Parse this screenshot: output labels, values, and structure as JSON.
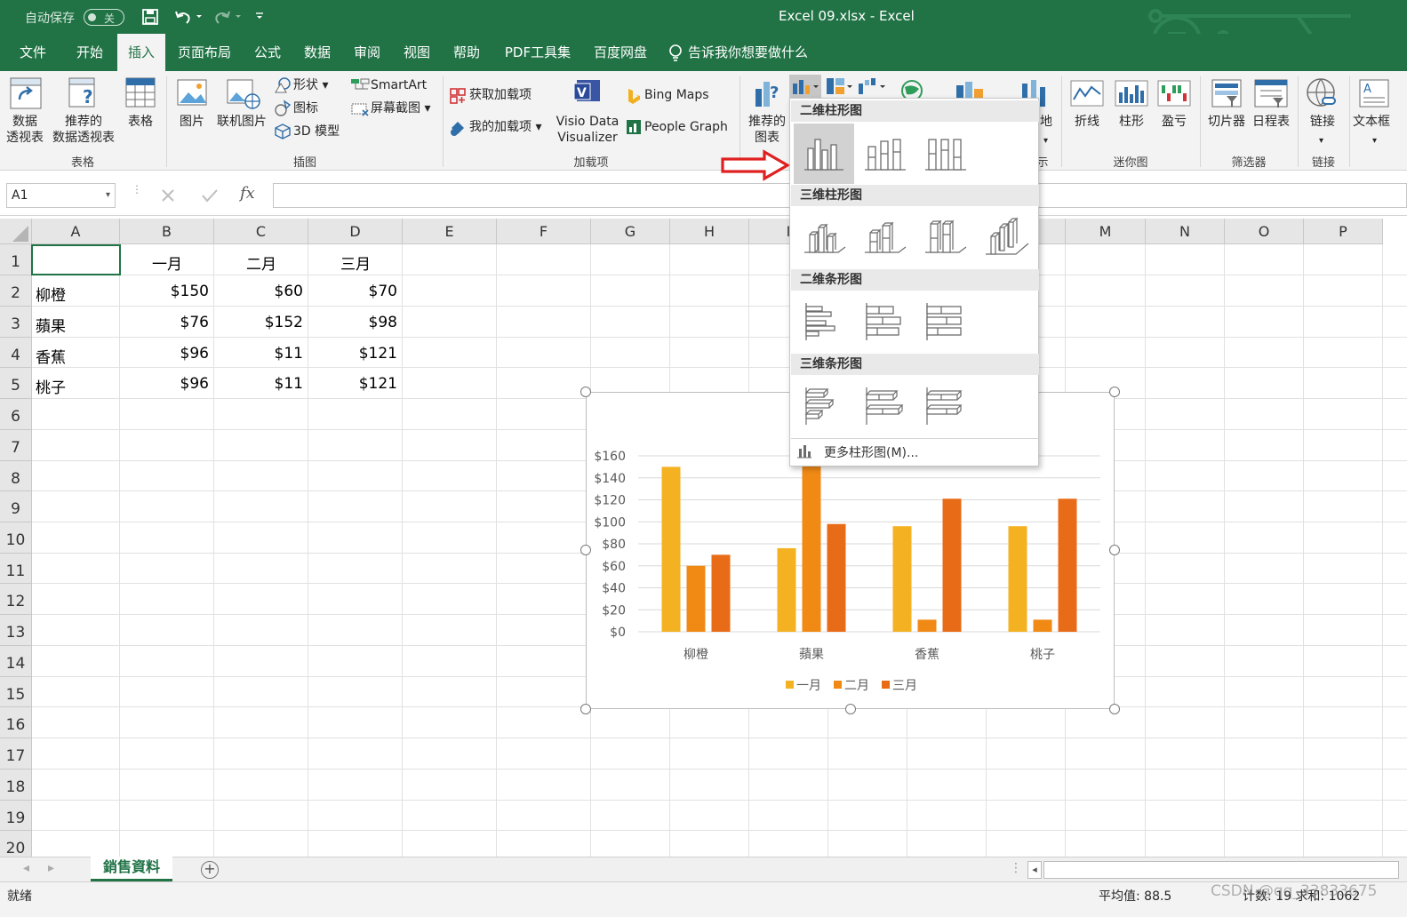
{
  "titlebar": {
    "autosave_label": "自动保存",
    "autosave_state": "关",
    "title": "Excel 09.xlsx  -  Excel"
  },
  "tabs": [
    {
      "label": "文件",
      "active": false
    },
    {
      "label": "开始",
      "active": false
    },
    {
      "label": "插入",
      "active": true
    },
    {
      "label": "页面布局",
      "active": false
    },
    {
      "label": "公式",
      "active": false
    },
    {
      "label": "数据",
      "active": false
    },
    {
      "label": "审阅",
      "active": false
    },
    {
      "label": "视图",
      "active": false
    },
    {
      "label": "帮助",
      "active": false
    },
    {
      "label": "PDF工具集",
      "active": false
    },
    {
      "label": "百度网盘",
      "active": false
    }
  ],
  "tellme": "告诉我你想要做什么",
  "ribbon": {
    "pivot": [
      "数据",
      "透视表"
    ],
    "recommended_pivot": [
      "推荐的",
      "数据透视表"
    ],
    "table": "表格",
    "group_tables": "表格",
    "picture": "图片",
    "online_picture": "联机图片",
    "shapes": "形状",
    "icons": "图标",
    "model3d": "3D 模型",
    "smartart": "SmartArt",
    "screenshot": "屏幕截图",
    "group_illustrations": "插图",
    "get_addins": "获取加载项",
    "my_addins": "我的加载项",
    "visio": [
      "Visio Data",
      "Visualizer"
    ],
    "bing_maps": "Bing Maps",
    "people_graph": "People Graph",
    "group_addins": "加载项",
    "recommended_charts": [
      "推荐的",
      "图表"
    ],
    "map_partial": "地",
    "show_partial": "示",
    "spark_line": "折线",
    "spark_column": "柱形",
    "spark_winloss": "盈亏",
    "group_sparklines": "迷你图",
    "slicer": "切片器",
    "timeline": "日程表",
    "group_filters": "筛选器",
    "link": "链接",
    "group_links": "链接",
    "textbox": "文本框"
  },
  "formula_bar": {
    "name_box": "A1",
    "fx": "fx"
  },
  "grid": {
    "columns": [
      "A",
      "B",
      "C",
      "D",
      "E",
      "F",
      "G",
      "H",
      "I",
      "",
      "",
      "L",
      "M",
      "N",
      "O",
      "P"
    ],
    "rows": [
      "1",
      "2",
      "3",
      "4",
      "5",
      "6",
      "7",
      "8",
      "9",
      "10",
      "11",
      "12",
      "13",
      "14",
      "15",
      "16",
      "17",
      "18",
      "19",
      "20"
    ],
    "cells": [
      {
        "row": 0,
        "col": 1,
        "text": "一月",
        "align": "center"
      },
      {
        "row": 0,
        "col": 2,
        "text": "二月",
        "align": "center"
      },
      {
        "row": 0,
        "col": 3,
        "text": "三月",
        "align": "center"
      },
      {
        "row": 1,
        "col": 0,
        "text": "柳橙",
        "align": "left"
      },
      {
        "row": 1,
        "col": 1,
        "text": "$150",
        "align": "right"
      },
      {
        "row": 1,
        "col": 2,
        "text": "$60",
        "align": "right"
      },
      {
        "row": 1,
        "col": 3,
        "text": "$70",
        "align": "right"
      },
      {
        "row": 2,
        "col": 0,
        "text": "蘋果",
        "align": "left"
      },
      {
        "row": 2,
        "col": 1,
        "text": "$76",
        "align": "right"
      },
      {
        "row": 2,
        "col": 2,
        "text": "$152",
        "align": "right"
      },
      {
        "row": 2,
        "col": 3,
        "text": "$98",
        "align": "right"
      },
      {
        "row": 3,
        "col": 0,
        "text": "香蕉",
        "align": "left"
      },
      {
        "row": 3,
        "col": 1,
        "text": "$96",
        "align": "right"
      },
      {
        "row": 3,
        "col": 2,
        "text": "$11",
        "align": "right"
      },
      {
        "row": 3,
        "col": 3,
        "text": "$121",
        "align": "right"
      },
      {
        "row": 4,
        "col": 0,
        "text": "桃子",
        "align": "left"
      },
      {
        "row": 4,
        "col": 1,
        "text": "$96",
        "align": "right"
      },
      {
        "row": 4,
        "col": 2,
        "text": "$11",
        "align": "right"
      },
      {
        "row": 4,
        "col": 3,
        "text": "$121",
        "align": "right"
      }
    ]
  },
  "chart_data": {
    "type": "bar",
    "categories": [
      "柳橙",
      "蘋果",
      "香蕉",
      "桃子"
    ],
    "series": [
      {
        "name": "一月",
        "values": [
          150,
          76,
          96,
          96
        ],
        "color": "#F4B223"
      },
      {
        "name": "二月",
        "values": [
          60,
          152,
          11,
          11
        ],
        "color": "#F18A15"
      },
      {
        "name": "三月",
        "values": [
          70,
          98,
          121,
          121
        ],
        "color": "#E86B17"
      }
    ],
    "yticks": [
      "$0",
      "$20",
      "$40",
      "$60",
      "$80",
      "$100",
      "$120",
      "$140",
      "$160"
    ],
    "ylim": [
      0,
      160
    ],
    "grid": true,
    "legend": "bottom"
  },
  "dropdown": {
    "sec_2d_column": "二维柱形图",
    "sec_3d_column": "三维柱形图",
    "sec_2d_bar": "二维条形图",
    "sec_3d_bar": "三维条形图",
    "more": "更多柱形图(M)..."
  },
  "sheets": [
    {
      "label": "銷售資料",
      "active": true
    }
  ],
  "status": {
    "ready": "就绪",
    "average": "平均值: 88.5",
    "count_sum": "计数: 19    求和: 1062",
    "watermark": "CSDN @qq_33833675"
  },
  "colors": {
    "excel_green": "#217346",
    "arrow_red": "#E02020"
  }
}
